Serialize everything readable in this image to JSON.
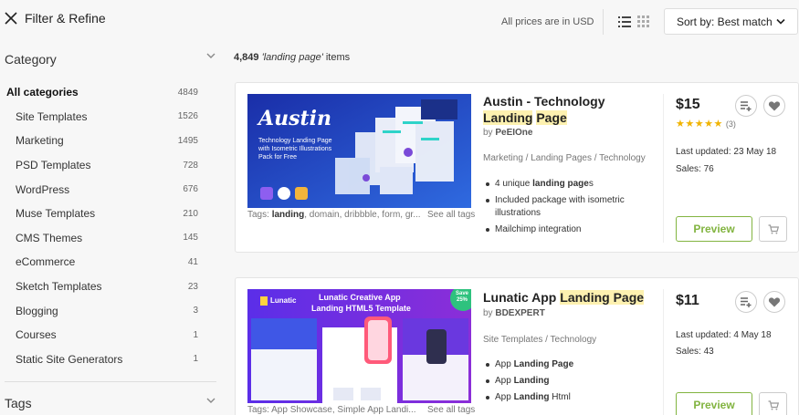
{
  "topbar": {
    "filter_label": "Filter & Refine",
    "prices_note": "All prices are in USD",
    "sort_label": "Sort by: Best match"
  },
  "sidebar": {
    "category_title": "Category",
    "categories": [
      {
        "label": "All categories",
        "count": "4849"
      },
      {
        "label": "Site Templates",
        "count": "1526"
      },
      {
        "label": "Marketing",
        "count": "1495"
      },
      {
        "label": "PSD Templates",
        "count": "728"
      },
      {
        "label": "WordPress",
        "count": "676"
      },
      {
        "label": "Muse Templates",
        "count": "210"
      },
      {
        "label": "CMS Themes",
        "count": "145"
      },
      {
        "label": "eCommerce",
        "count": "41"
      },
      {
        "label": "Sketch Templates",
        "count": "23"
      },
      {
        "label": "Blogging",
        "count": "3"
      },
      {
        "label": "Courses",
        "count": "1"
      },
      {
        "label": "Static Site Generators",
        "count": "1"
      }
    ],
    "tags_title": "Tags"
  },
  "results": {
    "count": "4,849",
    "query": "'landing page'",
    "suffix": "items"
  },
  "items": [
    {
      "title_pre": "Austin - Technology ",
      "title_hl1": "Landing",
      "title_hl2": "Page",
      "by": "by",
      "author": "PeEIOne",
      "categories": "Marketing / Landing Pages / Technology",
      "features": [
        {
          "pre": "4 unique ",
          "bold": "landing page",
          "post": "s"
        },
        {
          "pre": "Included package with isometric illustrations",
          "bold": "",
          "post": ""
        },
        {
          "pre": "Mailchimp integration",
          "bold": "",
          "post": ""
        }
      ],
      "tags_prefix": "Tags: ",
      "tags_bold": "landing",
      "tags_rest": ", domain, dribbble, form, gr...",
      "see_all": "See all tags",
      "price": "$15",
      "rating_stars": 5,
      "rating_count": "(3)",
      "last_updated": "Last updated: 23 May 18",
      "sales": "Sales: 76",
      "preview_label": "Preview",
      "thumb": {
        "brand": "Austin",
        "line1": "Technology Landing Page",
        "line2": "with Isometric Illustrations",
        "line3": "Pack for Free"
      }
    },
    {
      "title_pre": "Lunatic App ",
      "title_hl1": "Landing Page",
      "title_hl2": "",
      "by": "by",
      "author": "BDEXPERT",
      "categories": "Site Templates / Technology",
      "features": [
        {
          "pre": "App ",
          "bold": "Landing Page",
          "post": ""
        },
        {
          "pre": "App ",
          "bold": "Landing",
          "post": ""
        },
        {
          "pre": "App ",
          "bold": "Landing",
          "post": " Html"
        }
      ],
      "tags_prefix": "Tags: ",
      "tags_bold": "",
      "tags_rest": "App Showcase, Simple App Landi...",
      "see_all": "See all tags",
      "price": "$11",
      "last_updated": "Last updated: 4 May 18",
      "sales": "Sales: 43",
      "preview_label": "Preview",
      "thumb": {
        "brand": "Lunatic",
        "line1": "Lunatic Creative App",
        "line2": "Landing HTML5 Template",
        "badge_top": "Save",
        "badge_bottom": "25%"
      }
    }
  ],
  "colors": {
    "accent_green": "#82b440",
    "highlight": "#fdf1b0",
    "star": "#f0b300"
  }
}
